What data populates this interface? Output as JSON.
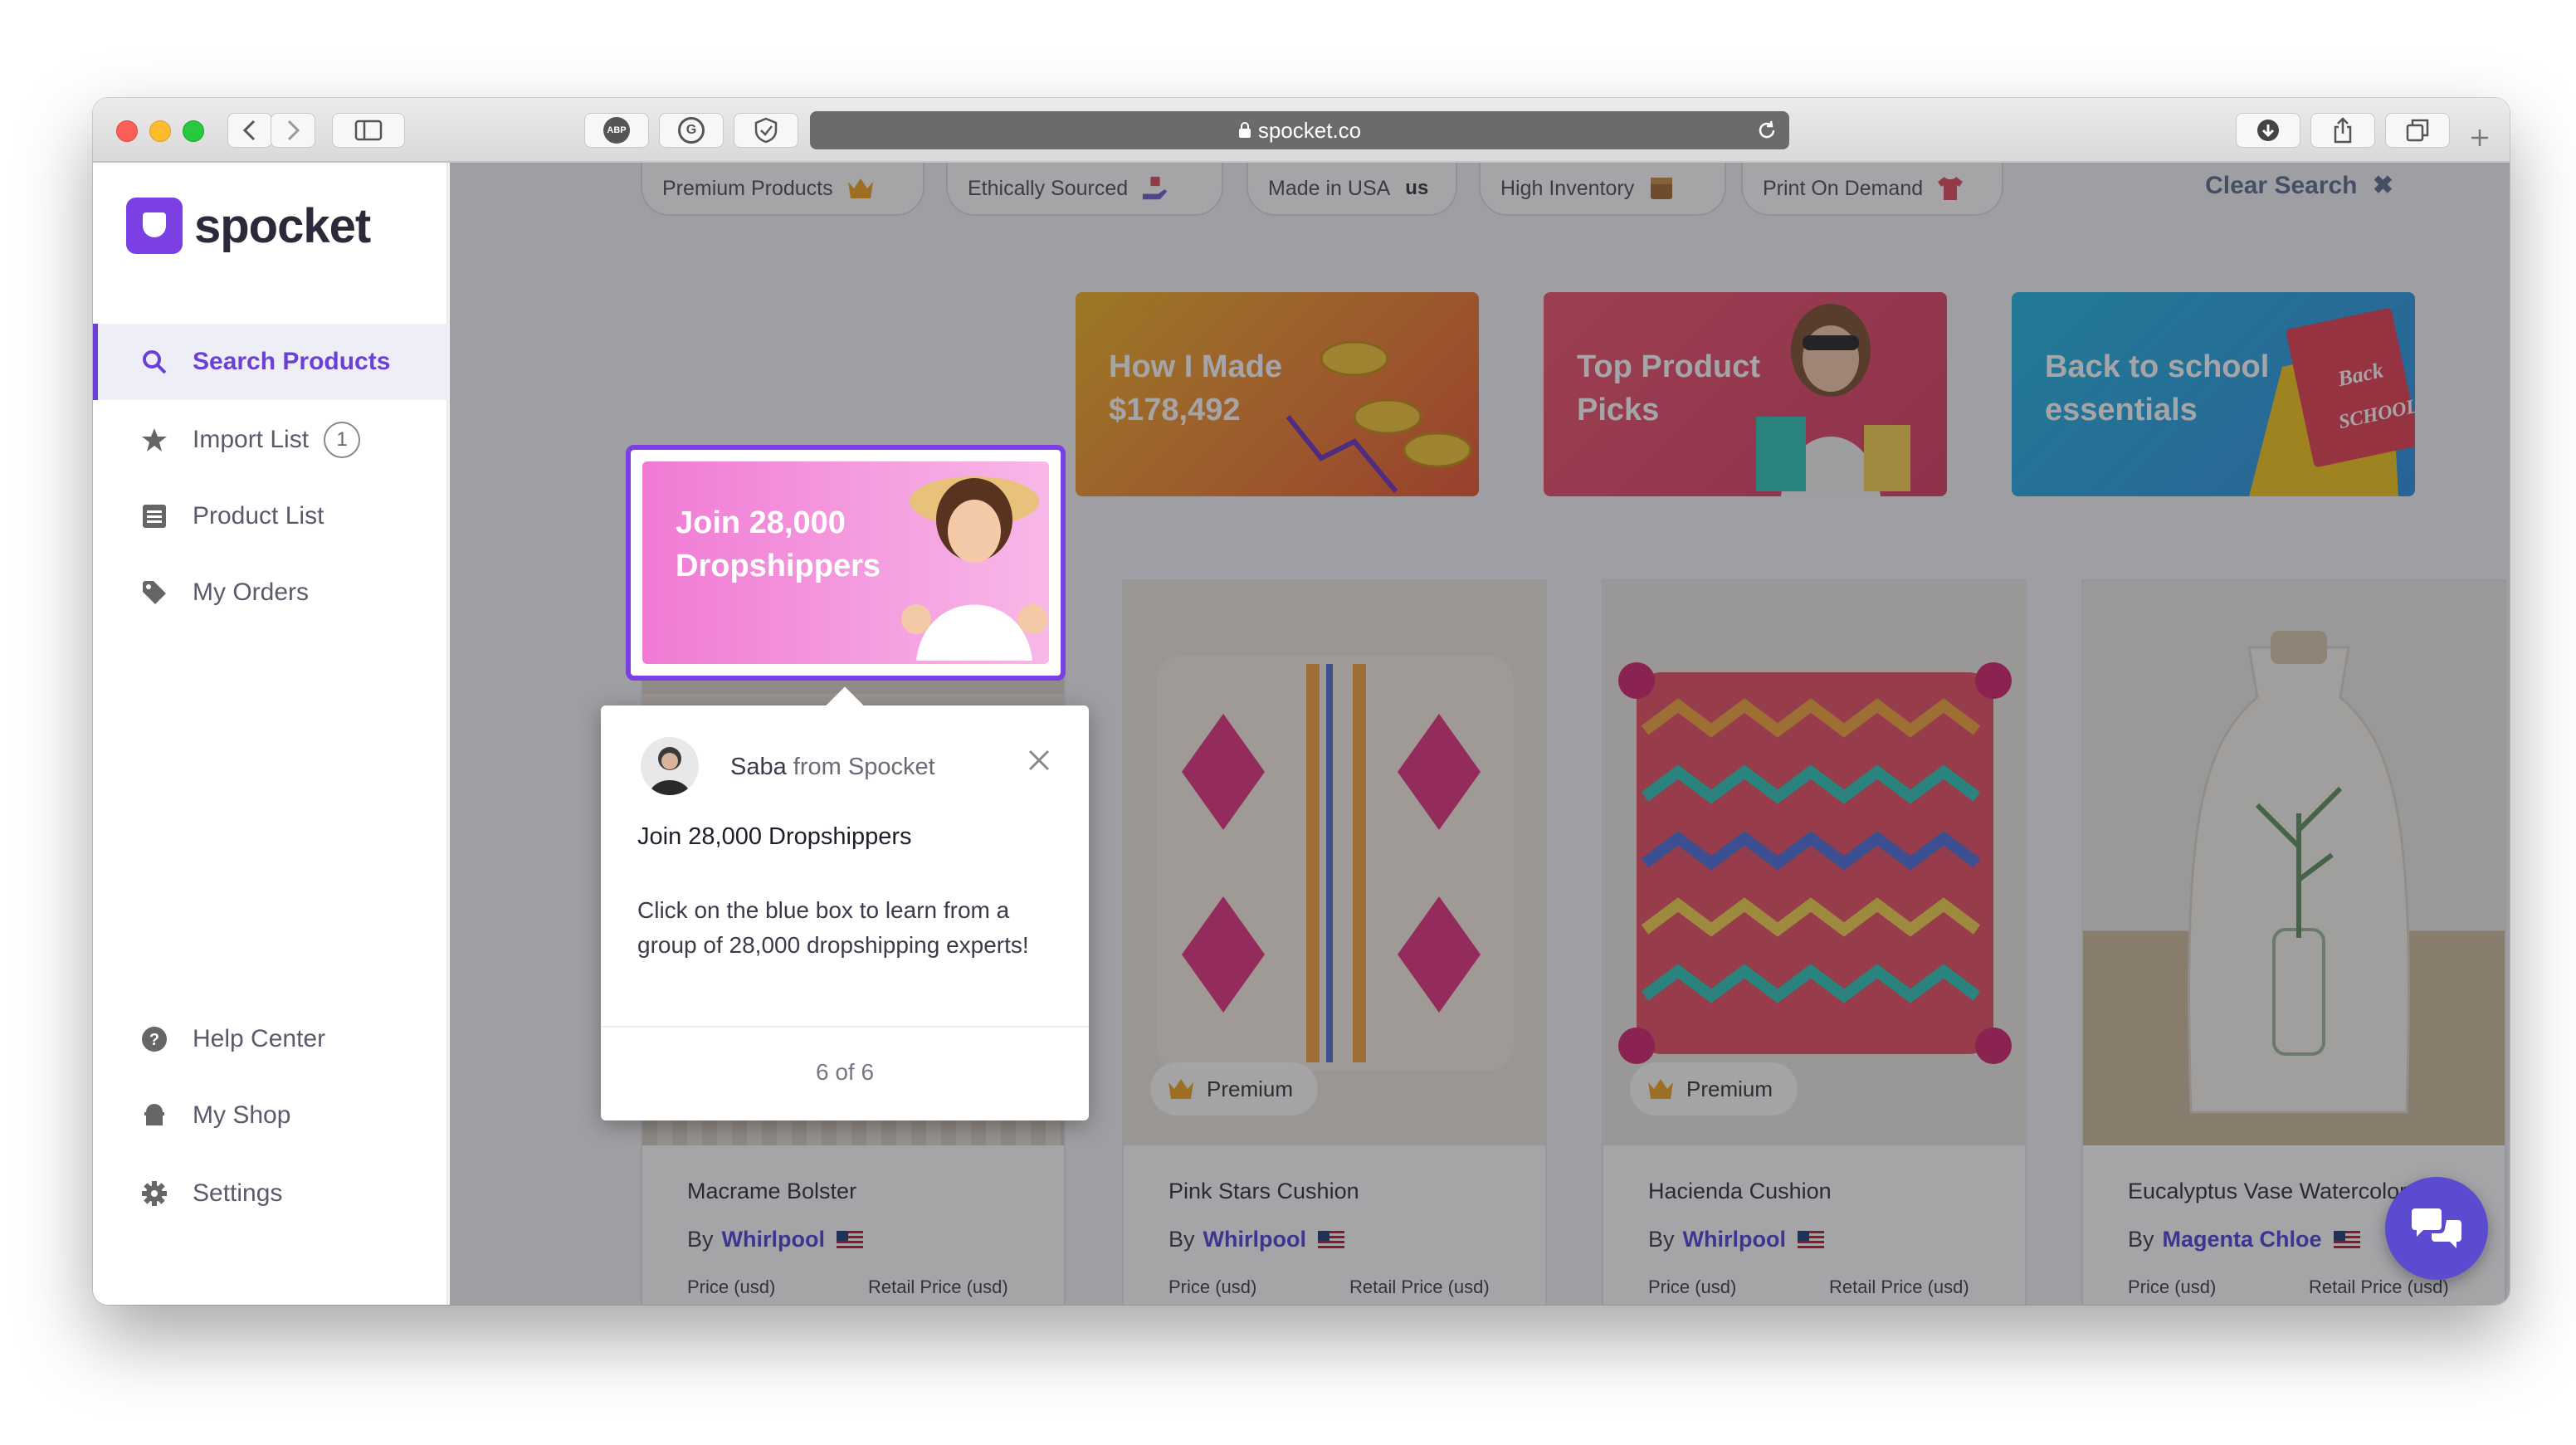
{
  "browser": {
    "url": "spocket.co",
    "toolbar_buttons": [
      "ABP",
      "G"
    ]
  },
  "brand": {
    "name": "spocket"
  },
  "sidebar": {
    "items": [
      {
        "label": "Search Products",
        "icon": "search-icon",
        "active": true
      },
      {
        "label": "Import List",
        "icon": "star-icon",
        "count": "1"
      },
      {
        "label": "Product List",
        "icon": "list-icon"
      },
      {
        "label": "My Orders",
        "icon": "tag-icon"
      }
    ],
    "bottom_items": [
      {
        "label": "Help Center",
        "icon": "help-icon"
      },
      {
        "label": "My Shop",
        "icon": "shop-icon"
      },
      {
        "label": "Settings",
        "icon": "gear-icon"
      }
    ]
  },
  "filters": {
    "chips": [
      {
        "label": "Premium Products",
        "icon": "crown-icon"
      },
      {
        "label": "Ethically Sourced",
        "icon": "hand-icon"
      },
      {
        "label": "Made in USA",
        "suffix": "us"
      },
      {
        "label": "High Inventory",
        "icon": "box-icon"
      },
      {
        "label": "Print On Demand",
        "icon": "shirt-icon"
      }
    ],
    "clear_label": "Clear Search"
  },
  "banners": [
    {
      "text": "Join 28,000 Dropshippers"
    },
    {
      "text": "How I Made $178,492"
    },
    {
      "text": "Top Product Picks"
    },
    {
      "text": "Back to school essentials"
    }
  ],
  "tooltip": {
    "author": "Saba",
    "from_text": "from Spocket",
    "title": "Join 28,000 Dropshippers",
    "body": "Click on the blue box to learn from a group of 28,000 dropshipping experts!",
    "step": "6 of 6"
  },
  "products": [
    {
      "name": "Macrame Bolster",
      "by": "By",
      "seller": "Whirlpool",
      "price_label": "Price (usd)",
      "retail_label": "Retail Price (usd)"
    },
    {
      "name": "Pink Stars Cushion",
      "by": "By",
      "seller": "Whirlpool",
      "badge": "Premium",
      "price_label": "Price (usd)",
      "retail_label": "Retail Price (usd)"
    },
    {
      "name": "Hacienda Cushion",
      "by": "By",
      "seller": "Whirlpool",
      "badge": "Premium",
      "price_label": "Price (usd)",
      "retail_label": "Retail Price (usd)"
    },
    {
      "name": "Eucalyptus Vase Watercolor ...",
      "by": "By",
      "seller": "Magenta Chloe",
      "price_label": "Price (usd)",
      "retail_label": "Retail Price (usd)"
    }
  ],
  "colors": {
    "accent": "#6b3fd8",
    "chat": "#5a4bd0"
  }
}
